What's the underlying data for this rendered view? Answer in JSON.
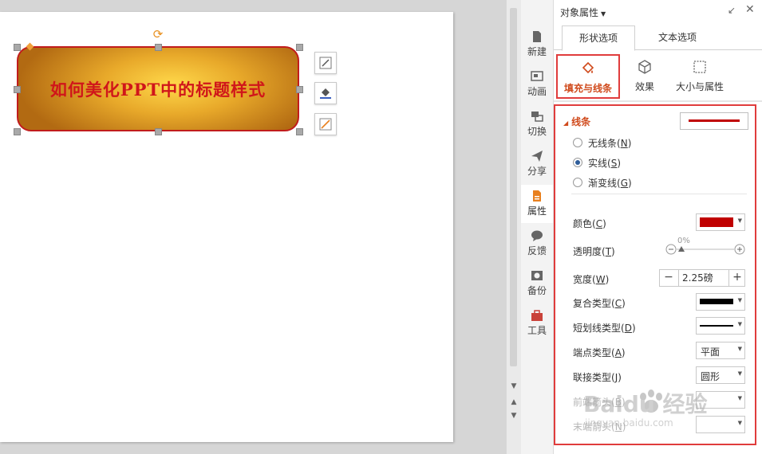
{
  "slide": {
    "shape_title": "如何美化PPT中的标题样式"
  },
  "sidenav": {
    "items": [
      {
        "label": "新建",
        "icon": "new-icon"
      },
      {
        "label": "动画",
        "icon": "animation-icon"
      },
      {
        "label": "切换",
        "icon": "transition-icon"
      },
      {
        "label": "分享",
        "icon": "share-icon"
      },
      {
        "label": "属性",
        "icon": "properties-icon"
      },
      {
        "label": "反馈",
        "icon": "feedback-icon"
      },
      {
        "label": "备份",
        "icon": "backup-icon"
      },
      {
        "label": "工具",
        "icon": "tools-icon"
      }
    ],
    "active": "属性"
  },
  "panel": {
    "title": "对象属性",
    "tabs": [
      "形状选项",
      "文本选项"
    ],
    "active_tab": "形状选项",
    "subtabs": [
      "填充与线条",
      "效果",
      "大小与属性"
    ],
    "active_subtab": "填充与线条",
    "section": "线条",
    "line_options": [
      {
        "label": "无线条",
        "key": "N",
        "checked": false
      },
      {
        "label": "实线",
        "key": "S",
        "checked": true
      },
      {
        "label": "渐变线",
        "key": "G",
        "checked": false
      }
    ],
    "props": {
      "color": {
        "label": "颜色",
        "key": "C",
        "value": "#c00000"
      },
      "transparency": {
        "label": "透明度",
        "key": "T",
        "value": "0%"
      },
      "width": {
        "label": "宽度",
        "key": "W",
        "value": "2.25磅",
        "minus": "−",
        "plus": "+"
      },
      "compound": {
        "label": "复合类型",
        "key": "C"
      },
      "dash": {
        "label": "短划线类型",
        "key": "D"
      },
      "cap": {
        "label": "端点类型",
        "key": "A",
        "value": "平面"
      },
      "join": {
        "label": "联接类型",
        "key": "J",
        "value": "圆形"
      },
      "begin_arrow": {
        "label": "前端箭头",
        "key": "B"
      },
      "end_arrow": {
        "label": "末端箭头",
        "key": "N"
      }
    }
  },
  "watermark": {
    "text": "Baidu 经验",
    "url": "jingyan.baidu.com"
  },
  "colors": {
    "accent": "#d04a1c",
    "highlight": "#e03c3c",
    "line": "#c00000"
  }
}
